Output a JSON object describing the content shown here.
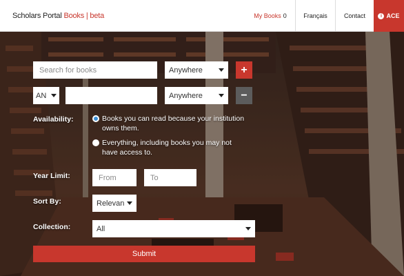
{
  "brand": {
    "name": "Scholars Portal",
    "books": "Books",
    "separator": "|",
    "beta": "beta"
  },
  "nav": {
    "my_books_label": "My Books",
    "my_books_count": "0",
    "french_label": "Français",
    "contact_label": "Contact",
    "ace_label": "ACE"
  },
  "search": {
    "row1": {
      "placeholder": "Search for books",
      "field": "Anywhere"
    },
    "row2": {
      "operator": "AN",
      "value": "",
      "field": "Anywhere"
    }
  },
  "availability": {
    "label": "Availability:",
    "options": [
      {
        "text": "Books you can read because your institution owns them.",
        "checked": true
      },
      {
        "text": "Everything, including books you may not have access to.",
        "checked": false
      }
    ]
  },
  "year_limit": {
    "label": "Year Limit:",
    "from_placeholder": "From",
    "to_placeholder": "To"
  },
  "sort_by": {
    "label": "Sort By:",
    "value": "Relevan"
  },
  "collection": {
    "label": "Collection:",
    "value": "All"
  },
  "submit_label": "Submit",
  "colors": {
    "accent": "#c8372d",
    "radio_checked": "#3c8fd6",
    "remove_button": "#5c5c5c"
  }
}
